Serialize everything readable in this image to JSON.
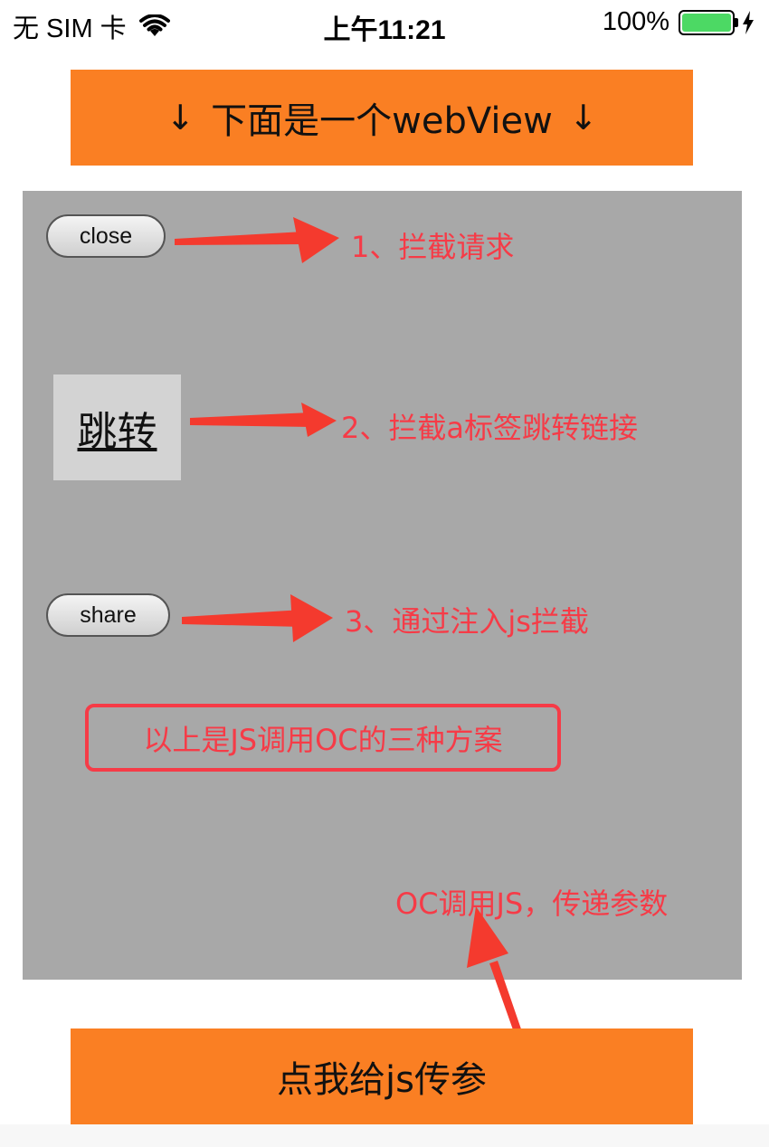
{
  "status_bar": {
    "carrier": "无 SIM 卡",
    "time": "上午11:21",
    "battery_percent": "100%",
    "battery_level": 1.0
  },
  "header": {
    "text": "下面是一个webView",
    "left_arrow": "↓",
    "right_arrow": "↓"
  },
  "webview": {
    "close_label": "close",
    "jump_link_label": "跳转",
    "share_label": "share"
  },
  "annotations": {
    "item1": "1、拦截请求",
    "item2": "2、拦截a标签跳转链接",
    "item3": "3、通过注入js拦截",
    "summary": "以上是JS调用OC的三种方案",
    "oc_to_js": "OC调用JS，传递参数"
  },
  "footer": {
    "button_label": "点我给js传参"
  },
  "colors": {
    "orange": "#fa7f23",
    "webview_bg": "#a8a8a8",
    "annotation_red": "#f63b47",
    "arrow_red": "#f43a2e",
    "battery_green": "#4cd964"
  }
}
